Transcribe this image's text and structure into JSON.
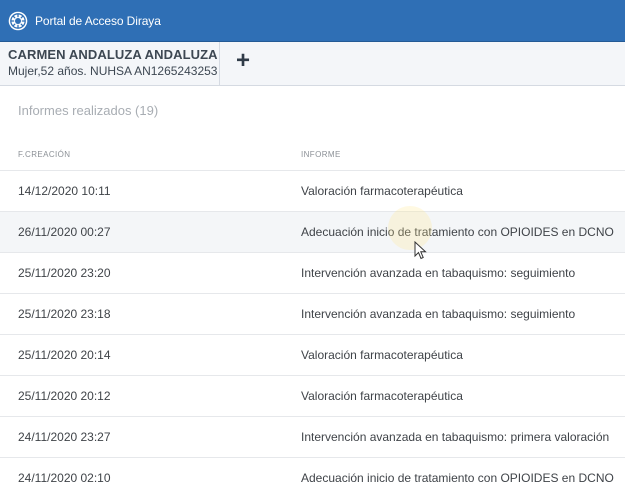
{
  "app": {
    "title": "Portal de Acceso Diraya",
    "logo_icon": "diraya-sun-logo-icon",
    "header_color": "#2f6fb5"
  },
  "patient": {
    "name": "CARMEN ANDALUZA ANDALUZA",
    "info": "Mujer,52 años. NUHSA AN1265243253",
    "add_label": "+"
  },
  "reports": {
    "title": "Informes realizados (19)",
    "columns": [
      "F.CREACIÓN",
      "INFORME"
    ],
    "rows": [
      {
        "date": "14/12/2020 10:11",
        "report": "Valoración farmacoterapéutica"
      },
      {
        "date": "26/11/2020 00:27",
        "report": "Adecuación inicio de tratamiento con OPIOIDES en DCNO"
      },
      {
        "date": "25/11/2020 23:20",
        "report": "Intervención avanzada en tabaquismo: seguimiento"
      },
      {
        "date": "25/11/2020 23:18",
        "report": "Intervención avanzada en tabaquismo: seguimiento"
      },
      {
        "date": "25/11/2020 20:14",
        "report": "Valoración farmacoterapéutica"
      },
      {
        "date": "25/11/2020 20:12",
        "report": "Valoración farmacoterapéutica"
      },
      {
        "date": "24/11/2020 23:27",
        "report": "Intervención avanzada en tabaquismo: primera valoración"
      },
      {
        "date": "24/11/2020 02:10",
        "report": "Adecuación inicio de tratamiento con OPIOIDES en DCNO"
      }
    ]
  }
}
